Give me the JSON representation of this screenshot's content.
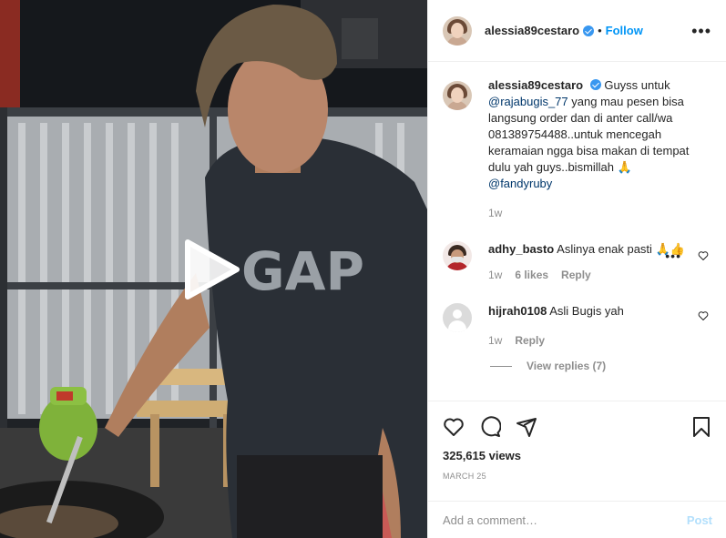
{
  "post": {
    "username": "alessia89cestaro",
    "follow_label": "Follow",
    "separator": "•",
    "more_label": "•••"
  },
  "caption": {
    "username": "alessia89cestaro",
    "text_before": "Guyss untuk",
    "mention1": "@rajabugis_77",
    "text_after": " yang mau pesen bisa langsung order dan di anter call/wa 081389754488..untuk mencegah keramaian ngga bisa makan di tempat dulu yah guys..bismillah 🙏",
    "mention2": "@fandyruby",
    "time": "1w"
  },
  "comments": [
    {
      "username": "adhy_basto",
      "text": "Aslinya enak pasti 🙏👍",
      "time": "1w",
      "likes": "6 likes",
      "reply_label": "Reply"
    },
    {
      "username": "hijrah0108",
      "text": "Asli Bugis yah",
      "time": "1w",
      "reply_label": "Reply",
      "view_replies": "View replies (7)"
    }
  ],
  "stats": {
    "views": "325,615 views",
    "date": "MARCH 25"
  },
  "add_comment": {
    "placeholder": "Add a comment…",
    "post_label": "Post"
  },
  "icons": {
    "like": "heart-icon",
    "comment": "comment-icon",
    "share": "share-icon",
    "save": "bookmark-icon",
    "play": "play-icon"
  },
  "colors": {
    "link": "#0095f6",
    "verified": "#3897f0",
    "muted": "#8e8e8e",
    "post_disabled": "#b2dffc"
  }
}
